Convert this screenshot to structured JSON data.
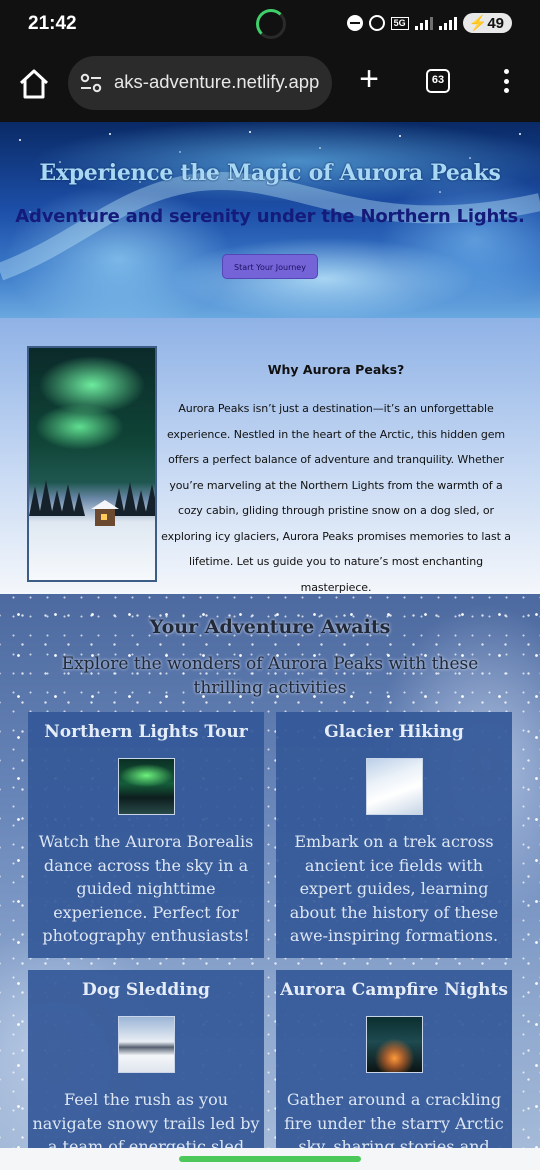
{
  "status_bar": {
    "time": "21:42",
    "network": "5G",
    "battery": "49",
    "icons": [
      "dnd-icon",
      "hotspot-icon",
      "network-icon",
      "signal-icon",
      "signal-icon",
      "battery-icon"
    ]
  },
  "browser": {
    "url": "aks-adventure.netlify.app",
    "tab_count": "63",
    "new_tab_label": "+",
    "icons": [
      "home-icon",
      "site-settings-icon",
      "plus-icon",
      "tabs-icon",
      "more-vert-icon"
    ]
  },
  "hero": {
    "title": "Experience the Magic of Aurora Peaks",
    "subtitle": "Adventure and serenity under the Northern Lights.",
    "cta_label": "Start Your Journey"
  },
  "about": {
    "heading": "Why Aurora Peaks?",
    "text": "Aurora Peaks isn’t just a destination—it’s an unforgettable experience. Nestled in the heart of the Arctic, this hidden gem offers a perfect balance of adventure and tranquility. Whether you’re marveling at the Northern Lights from the warmth of a cozy cabin, gliding through pristine snow on a dog sled, or exploring icy glaciers, Aurora Peaks promises memories to last a lifetime. Let us guide you to nature’s most enchanting masterpiece."
  },
  "activities": {
    "title": "Your Adventure Awaits",
    "subtitle": "Explore the wonders of Aurora Peaks with these thrilling activities",
    "cards": [
      {
        "title": "Northern Lights Tour",
        "text": "Watch the Aurora Borealis dance across the sky in a guided nighttime experience. Perfect for photography enthusiasts!"
      },
      {
        "title": "Glacier Hiking",
        "text": "Embark on a trek across ancient ice fields with expert guides, learning about the history of these awe-inspiring formations."
      },
      {
        "title": "Dog Sledding",
        "text": "Feel the rush as you navigate snowy trails led by a team of energetic sled dogs."
      },
      {
        "title": "Aurora Campfire Nights",
        "text": "Gather around a crackling fire under the starry Arctic sky, sharing stories and"
      }
    ]
  },
  "colors": {
    "hero_title": "#a8d8f4",
    "hero_subtitle": "#141b7a",
    "cta_background": "#7464d8",
    "card_background": "#345898",
    "gesture_bar": "#4cc85a"
  }
}
